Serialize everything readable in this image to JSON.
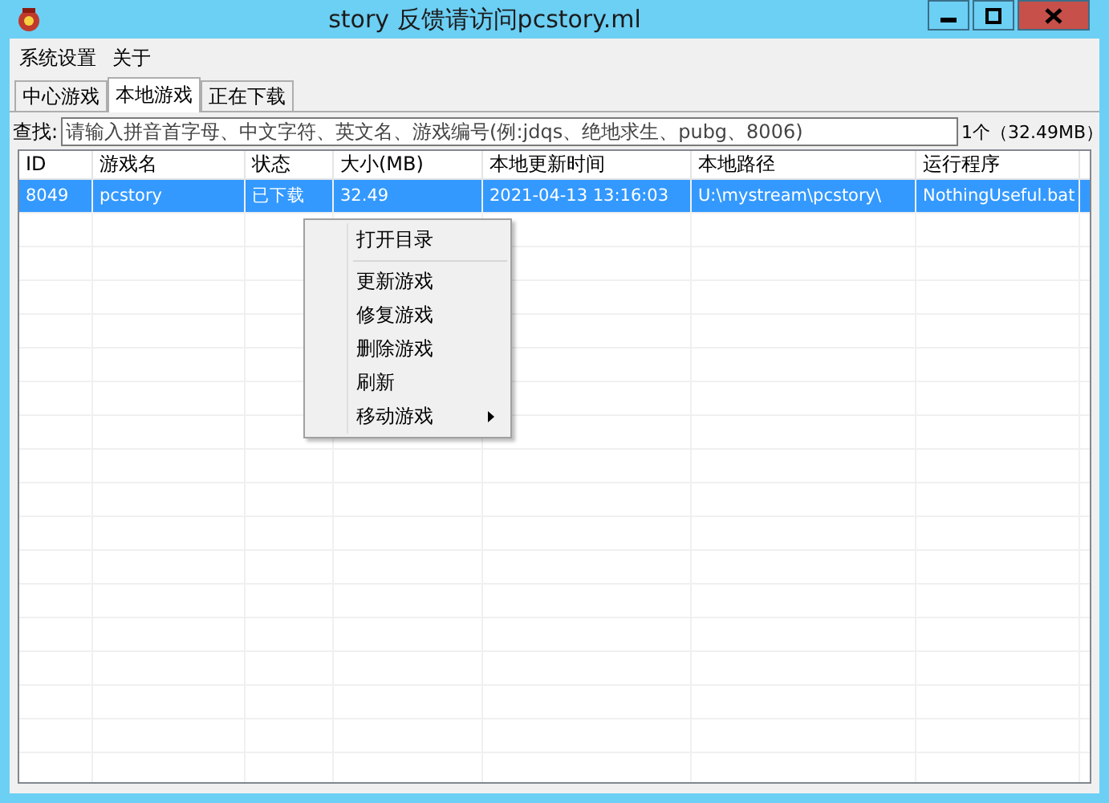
{
  "window": {
    "title": "story 反馈请访问pcstory.ml"
  },
  "menu_bar": [
    {
      "label": "系统设置"
    },
    {
      "label": "关于"
    }
  ],
  "tabs": [
    {
      "label": "中心游戏",
      "selected": false
    },
    {
      "label": "本地游戏",
      "selected": true
    },
    {
      "label": "正在下载",
      "selected": false
    }
  ],
  "search": {
    "label": "查找:",
    "placeholder": "请输入拼音首字母、中文字符、英文名、游戏编号(例:jdqs、绝地求生、pubg、8006)"
  },
  "summary": "1个（32.49MB）",
  "table": {
    "columns": [
      "ID",
      "游戏名",
      "状态",
      "大小(MB)",
      "本地更新时间",
      "本地路径",
      "运行程序"
    ],
    "rows": [
      {
        "selected": true,
        "cells": [
          "8049",
          "pcstory",
          "已下载",
          "32.49",
          "2021-04-13 13:16:03",
          "U:\\mystream\\pcstory\\",
          "NothingUseful.bat"
        ]
      }
    ]
  },
  "context_menu": {
    "items": [
      {
        "kind": "item",
        "label": "打开目录",
        "submenu": false
      },
      {
        "kind": "separator"
      },
      {
        "kind": "item",
        "label": "更新游戏",
        "submenu": false
      },
      {
        "kind": "item",
        "label": "修复游戏",
        "submenu": false
      },
      {
        "kind": "item",
        "label": "删除游戏",
        "submenu": false
      },
      {
        "kind": "item",
        "label": "刷新",
        "submenu": false
      },
      {
        "kind": "item",
        "label": "移动游戏",
        "submenu": true
      }
    ]
  }
}
